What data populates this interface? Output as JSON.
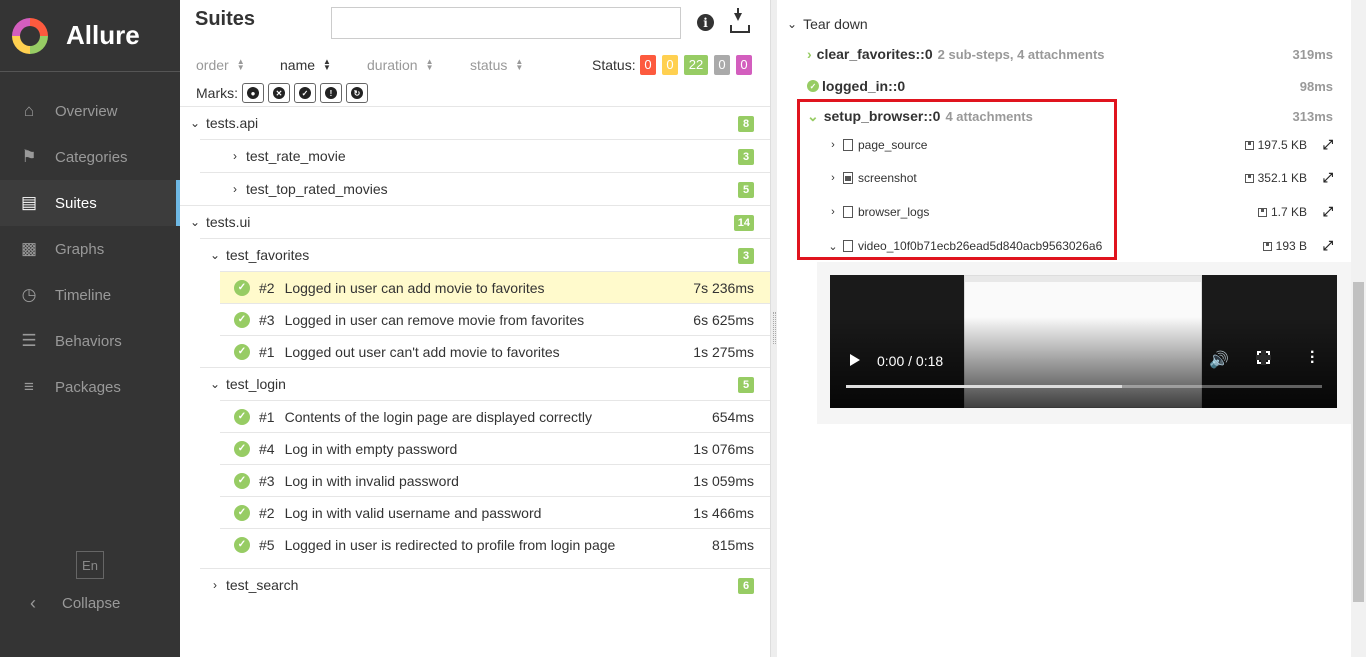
{
  "brand": {
    "name": "Allure"
  },
  "nav": [
    {
      "label": "Overview",
      "icon": "home-icon"
    },
    {
      "label": "Categories",
      "icon": "flag-icon"
    },
    {
      "label": "Suites",
      "icon": "briefcase-icon"
    },
    {
      "label": "Graphs",
      "icon": "bar-chart-icon"
    },
    {
      "label": "Timeline",
      "icon": "clock-icon"
    },
    {
      "label": "Behaviors",
      "icon": "list-icon"
    },
    {
      "label": "Packages",
      "icon": "align-left-icon"
    }
  ],
  "active_nav": "Suites",
  "language": "En",
  "collapse_label": "Collapse",
  "suites": {
    "title": "Suites",
    "search_value": "",
    "sort": {
      "order": "order",
      "name": "name",
      "duration": "duration",
      "status": "status"
    },
    "status_label": "Status:",
    "status_counts": [
      {
        "value": "0",
        "color": "#fd5a3e"
      },
      {
        "value": "0",
        "color": "#ffd050"
      },
      {
        "value": "22",
        "color": "#97cc64"
      },
      {
        "value": "0",
        "color": "#aaaaaa"
      },
      {
        "value": "0",
        "color": "#d35ebe"
      }
    ],
    "marks_label": "Marks:",
    "tree": {
      "api": {
        "name": "tests.api",
        "count": "8",
        "children": [
          {
            "name": "test_rate_movie",
            "count": "3"
          },
          {
            "name": "test_top_rated_movies",
            "count": "5"
          }
        ]
      },
      "ui": {
        "name": "tests.ui",
        "count": "14",
        "favorites": {
          "name": "test_favorites",
          "count": "3",
          "tests": [
            {
              "order": "#2",
              "name": "Logged in user can add movie to favorites",
              "duration": "7s 236ms"
            },
            {
              "order": "#3",
              "name": "Logged in user can remove movie from favorites",
              "duration": "6s 625ms"
            },
            {
              "order": "#1",
              "name": "Logged out user can't add movie to favorites",
              "duration": "1s 275ms"
            }
          ]
        },
        "login": {
          "name": "test_login",
          "count": "5",
          "tests": [
            {
              "order": "#1",
              "name": "Contents of the login page are displayed correctly",
              "duration": "654ms"
            },
            {
              "order": "#4",
              "name": "Log in with empty password",
              "duration": "1s 076ms"
            },
            {
              "order": "#3",
              "name": "Log in with invalid password",
              "duration": "1s 059ms"
            },
            {
              "order": "#2",
              "name": "Log in with valid username and password",
              "duration": "1s 466ms"
            },
            {
              "order": "#5",
              "name": "Logged in user is redirected to profile from login page",
              "duration": "815ms"
            }
          ]
        },
        "search": {
          "name": "test_search",
          "count": "6"
        }
      }
    }
  },
  "details": {
    "section": "Tear down",
    "steps": [
      {
        "name": "clear_favorites::0",
        "meta": "2 sub-steps, 4 attachments",
        "duration": "319ms"
      },
      {
        "name": "logged_in::0",
        "meta": "",
        "duration": "98ms"
      },
      {
        "name": "setup_browser::0",
        "meta": "4 attachments",
        "duration": "313ms"
      }
    ],
    "attachments": [
      {
        "name": "page_source",
        "size": "197.5 KB",
        "icon": "code-file-icon"
      },
      {
        "name": "screenshot",
        "size": "352.1 KB",
        "icon": "image-file-icon"
      },
      {
        "name": "browser_logs",
        "size": "1.7 KB",
        "icon": "text-file-icon"
      },
      {
        "name": "video_10f0b71ecb26ead5d840acb9563026a6",
        "size": "193 B",
        "icon": "video-file-icon"
      }
    ],
    "video": {
      "time": "0:00 / 0:18",
      "progress": 0.58
    }
  }
}
